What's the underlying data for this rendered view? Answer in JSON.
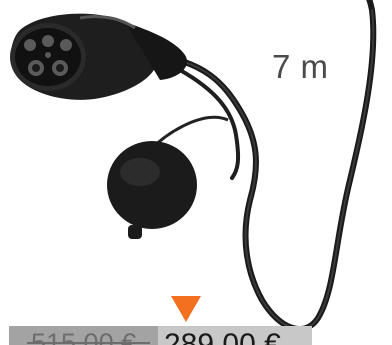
{
  "product": {
    "image_icon": "ev-charging-cable-type2-icon",
    "length_label": "7 m"
  },
  "pricing": {
    "old_price": "515,00 €",
    "new_price": "289,00 €",
    "marker_icon": "triangle-down-icon",
    "colors": {
      "marker": "#f37021",
      "old_bg": "#a3a3a3",
      "new_bg": "#c8c8c8"
    }
  }
}
